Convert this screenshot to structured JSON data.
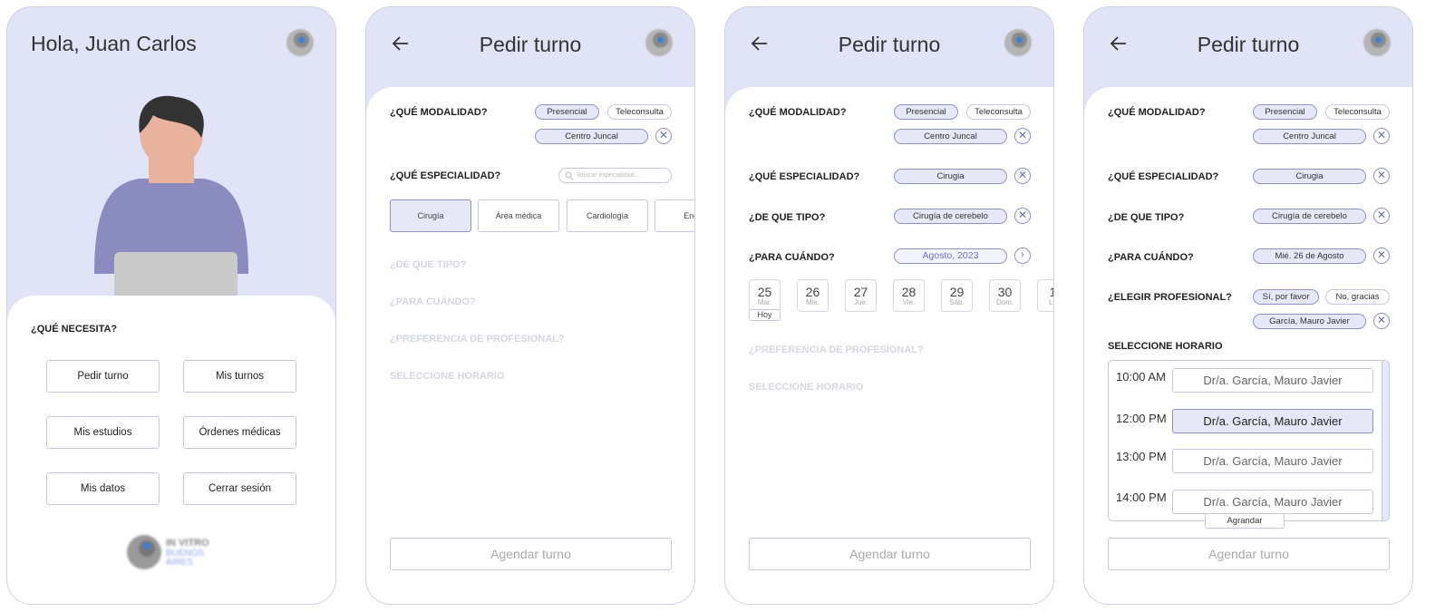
{
  "screen1": {
    "greeting": "Hola, Juan Carlos",
    "need_label": "¿QUÉ NECESITA?",
    "buttons": [
      "Pedir turno",
      "Mis turnos",
      "Mis estudios",
      "Órdenes médicas",
      "Mis datos",
      "Cerrar sesión"
    ],
    "logo_text": [
      "IN VITRO",
      "BUENOS",
      "AIRES"
    ]
  },
  "screen2": {
    "title": "Pedir turno",
    "modalidad_label": "¿QUÉ MODALIDAD?",
    "modalidad_options": [
      "Presencial",
      "Teleconsulta"
    ],
    "center": "Centro Juncal",
    "especialidad_label": "¿QUÉ ESPECIALIDAD?",
    "search_placeholder": "Buscar especialidad...",
    "specialties": [
      "Cirugía",
      "Área médica",
      "Cardiología",
      "Endos"
    ],
    "tipo_label": "¿DE QUE TIPO?",
    "cuando_label": "¿PARA CUÁNDO?",
    "pref_label": "¿PREFERENCIA DE PROFESIONAL?",
    "horario_label": "SELECCIONE HORARIO",
    "submit": "Agendar turno"
  },
  "screen3": {
    "title": "Pedir turno",
    "modalidad_label": "¿QUÉ MODALIDAD?",
    "modalidad_options": [
      "Presencial",
      "Teleconsulta"
    ],
    "center": "Centro Juncal",
    "especialidad_label": "¿QUÉ ESPECIALIDAD?",
    "especialidad_value": "Cirugia",
    "tipo_label": "¿DE QUE TIPO?",
    "tipo_value": "Cirugía de cerebelo",
    "cuando_label": "¿PARA CUÁNDO?",
    "month_value": "Agosto, 2023",
    "days": [
      {
        "num": "25",
        "dow": "Mar."
      },
      {
        "num": "26",
        "dow": "Mie."
      },
      {
        "num": "27",
        "dow": "Jue."
      },
      {
        "num": "28",
        "dow": "Vie."
      },
      {
        "num": "29",
        "dow": "Sáb."
      },
      {
        "num": "30",
        "dow": "Dom."
      },
      {
        "num": "1",
        "dow": "Lu"
      }
    ],
    "today_tag": "Hoy",
    "pref_label": "¿PREFERENCIA DE PROFESIONAL?",
    "horario_label": "SELECCIONE HORARIO",
    "submit": "Agendar turno"
  },
  "screen4": {
    "title": "Pedir turno",
    "modalidad_label": "¿QUÉ MODALIDAD?",
    "modalidad_options": [
      "Presencial",
      "Teleconsulta"
    ],
    "center": "Centro Juncal",
    "especialidad_label": "¿QUÉ ESPECIALIDAD?",
    "especialidad_value": "Cirugia",
    "tipo_label": "¿DE QUE TIPO?",
    "tipo_value": "Cirugía de cerebelo",
    "cuando_label": "¿PARA CUÁNDO?",
    "date_value": "Mié. 26 de Agosto",
    "profesional_label": "¿ELEGIR PROFESIONAL?",
    "profesional_options": [
      "Sí, por favor",
      "No, gracias"
    ],
    "profesional_value": "García, Mauro Javier",
    "horario_label": "SELECCIONE HORARIO",
    "slots": [
      {
        "time": "10:00 AM",
        "doctor": "Dr/a. García, Mauro Javier"
      },
      {
        "time": "12:00 PM",
        "doctor": "Dr/a. García, Mauro Javier"
      },
      {
        "time": "13:00 PM",
        "doctor": "Dr/a. García, Mauro Javier"
      },
      {
        "time": "14:00 PM",
        "doctor": "Dr/a. García, Mauro Javier"
      }
    ],
    "expand": "Agrandar",
    "submit": "Agendar turno"
  }
}
